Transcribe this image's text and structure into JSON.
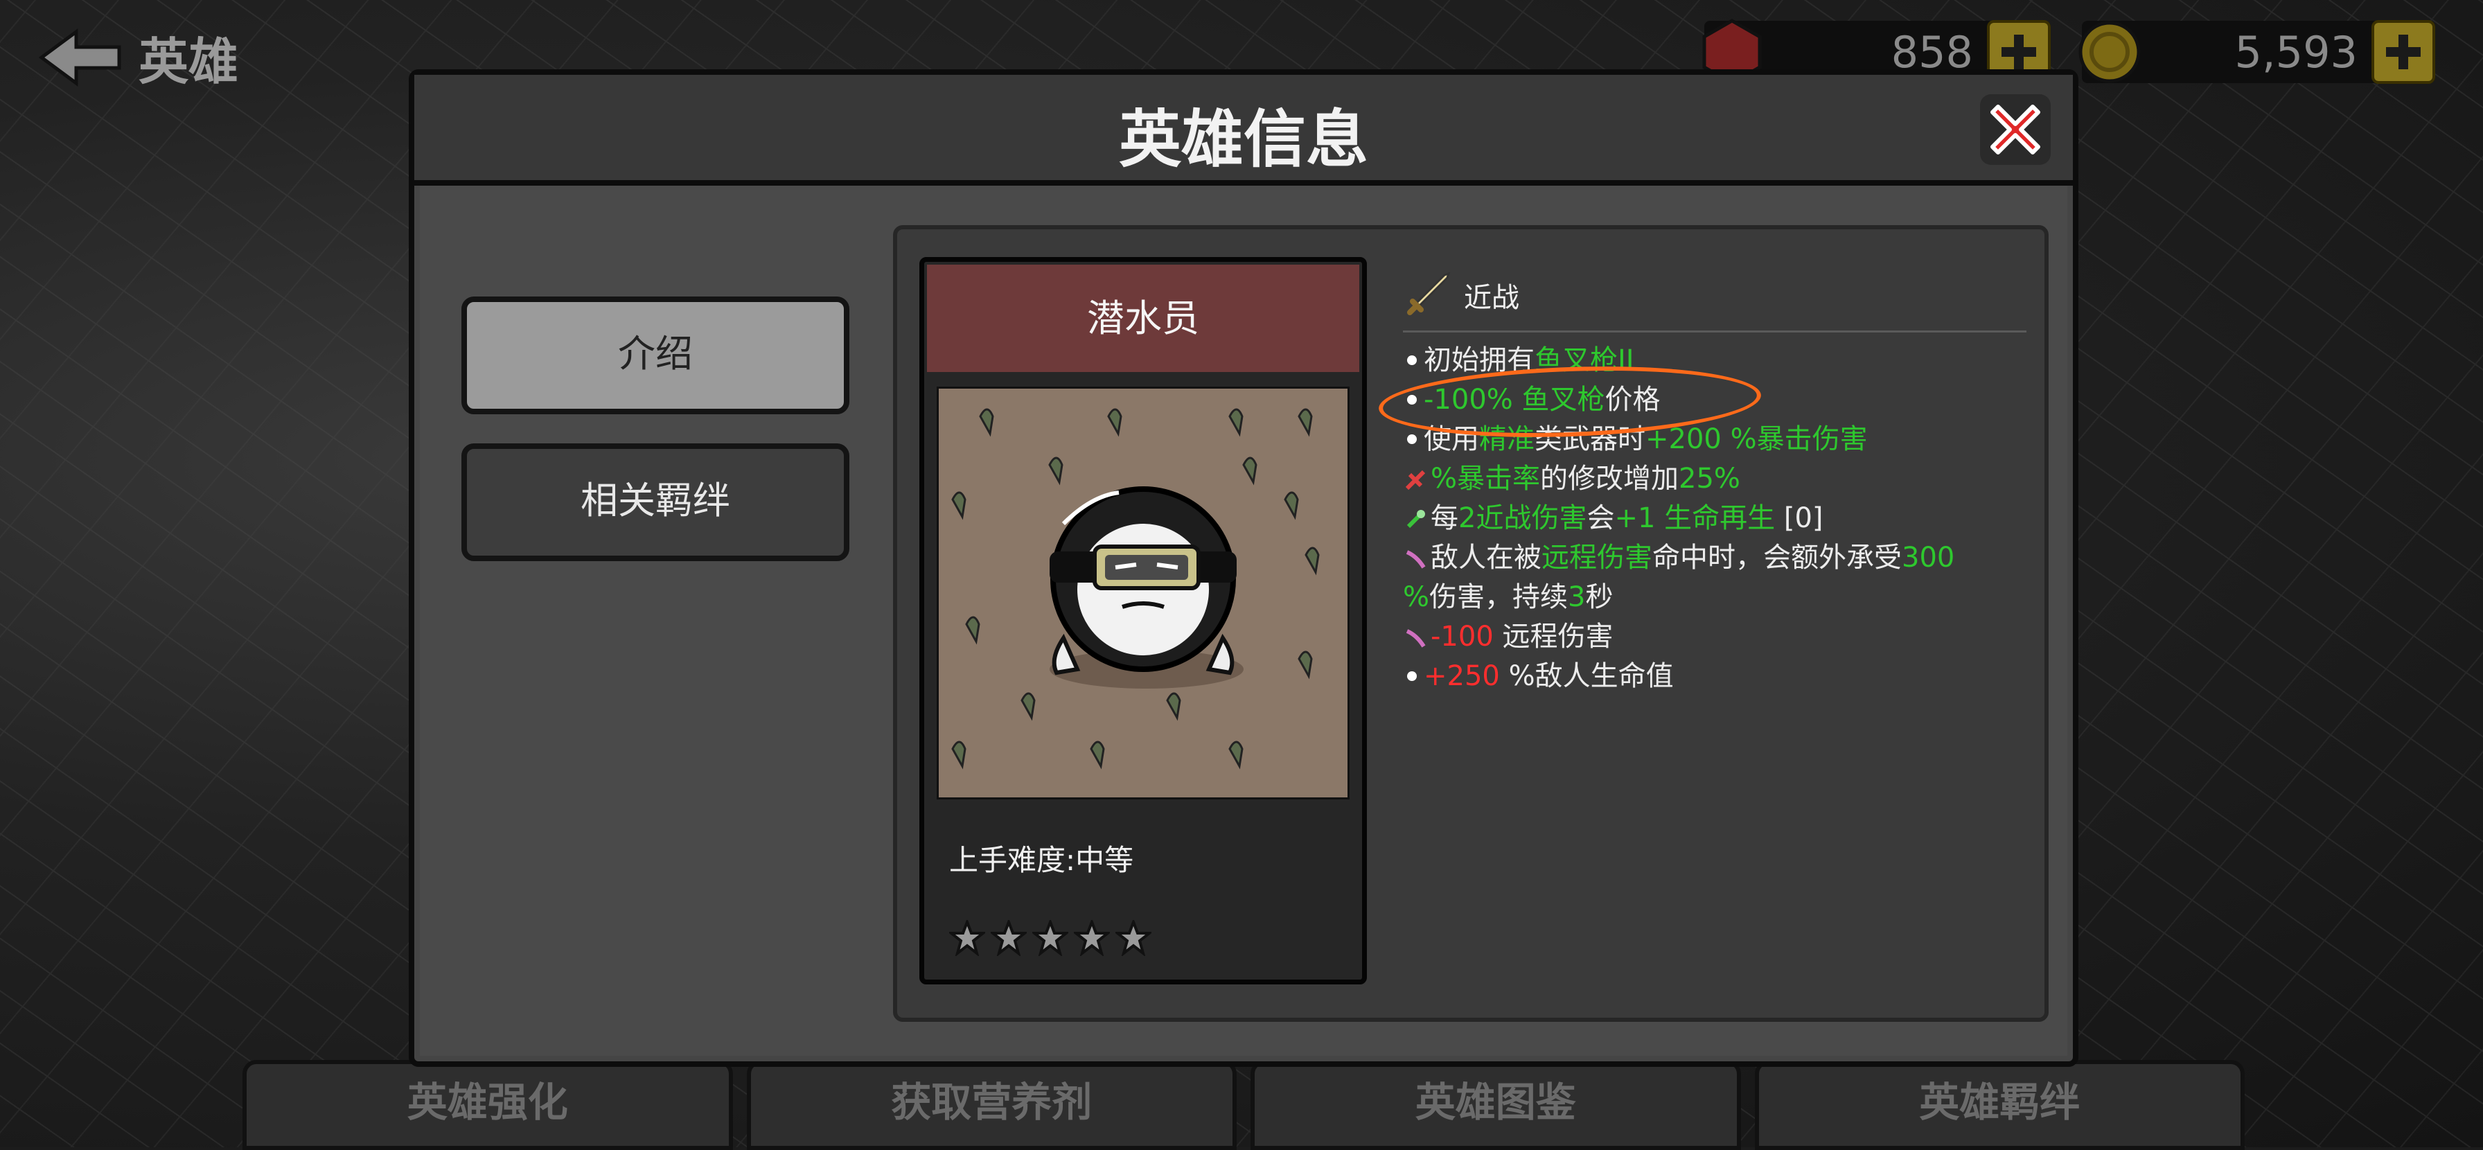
{
  "topbar": {
    "back_label": "英雄",
    "gems": "858",
    "coins": "5,593"
  },
  "bottom_tabs": [
    "英雄强化",
    "获取营养剂",
    "英雄图鉴",
    "英雄羁绊"
  ],
  "modal": {
    "title": "英雄信息",
    "side_tabs": {
      "intro": "介绍",
      "bonds": "相关羁绊"
    },
    "card": {
      "name": "潜水员",
      "difficulty": "上手难度:中等",
      "stars_total": 5,
      "stars_filled": 0
    },
    "info": {
      "type_label": "近战",
      "l1a": "初始拥有",
      "l1b": "鱼叉枪II",
      "l2a": "-100% 鱼叉枪",
      "l2b": "价格",
      "l3a": "使用",
      "l3b": "精准",
      "l3c": "类武器时",
      "l3d": "+200 %暴击伤害",
      "l4a": "%暴击率",
      "l4b": "的修改增加",
      "l4c": "25%",
      "l5a": "每",
      "l5b": "2近战伤害",
      "l5c": "会",
      "l5d": "+1 生命再生",
      "l5e": " [0]",
      "l6a": "敌人在被",
      "l6b": "远程伤害",
      "l6c": "命中时，会额外承受",
      "l6d": "300",
      "l7a": "%",
      "l7b": "伤害，持续",
      "l7c": "3",
      "l7d": "秒",
      "l8a": "-100",
      "l8b": " 远程伤害",
      "l9a": "+250",
      "l9b": " %敌人生命值"
    }
  },
  "colors": {
    "positive": "#2ec82e",
    "negative": "#ff2e2e",
    "highlight_circle": "#ff6a1a"
  }
}
